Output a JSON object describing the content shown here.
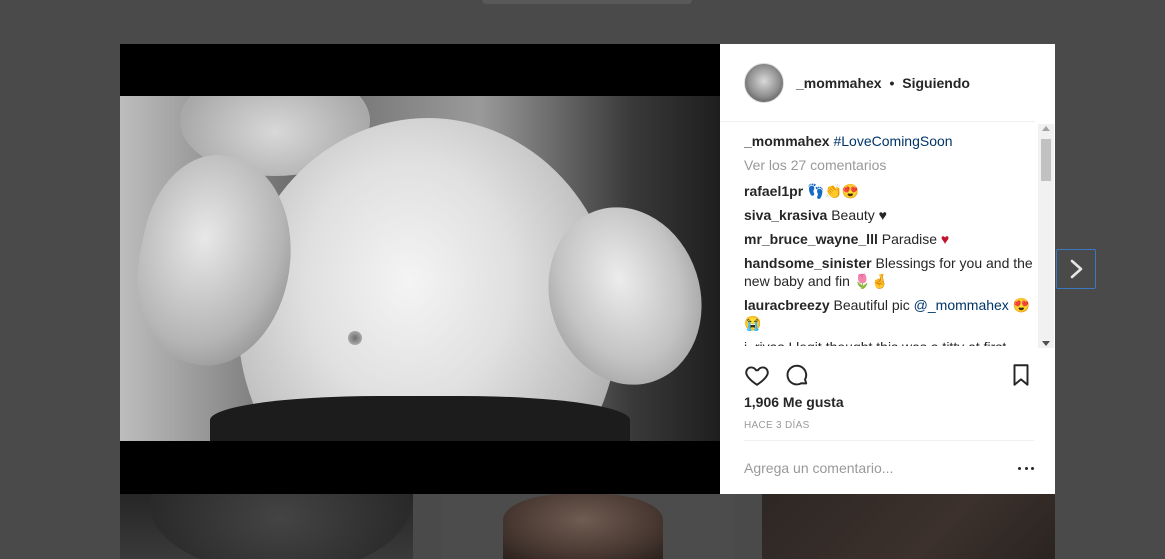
{
  "post": {
    "username": "_mommahex",
    "separator": "•",
    "follow_status": "Siguiendo",
    "caption_user": "_mommahex",
    "caption_tag": "#LoveComingSoon",
    "view_all": "Ver los 27 comentarios",
    "comments": [
      {
        "user": "rafael1pr",
        "text": "👣👏😍"
      },
      {
        "user": "siva_krasiva",
        "text": "Beauty ♥"
      },
      {
        "user": "mr_bruce_wayne_lll",
        "text": "Paradise ♥"
      },
      {
        "user": "handsome_sinister",
        "text": "Blessings for you and the new baby and fin 🌷🤞"
      },
      {
        "user": "lauracbreezy",
        "text": "Beautiful pic ",
        "mention": "@_mommahex",
        "text2": " 😍😭"
      }
    ],
    "cut_off_comment": "i_rivas I legit thought this was a titty at first",
    "likes": "1,906 Me gusta",
    "time": "HACE 3 DÍAS",
    "add_comment_placeholder": "Agrega un comentario..."
  },
  "icons": {
    "like": "heart-icon",
    "comment": "comment-bubble-icon",
    "save": "bookmark-icon",
    "more": "more-options-icon",
    "next": "chevron-right-icon"
  },
  "colors": {
    "overlay": "#4a4a4a",
    "link": "#003569",
    "muted": "#999999",
    "heart_red": "#c0142a",
    "arrow_border": "#3b78c0"
  }
}
